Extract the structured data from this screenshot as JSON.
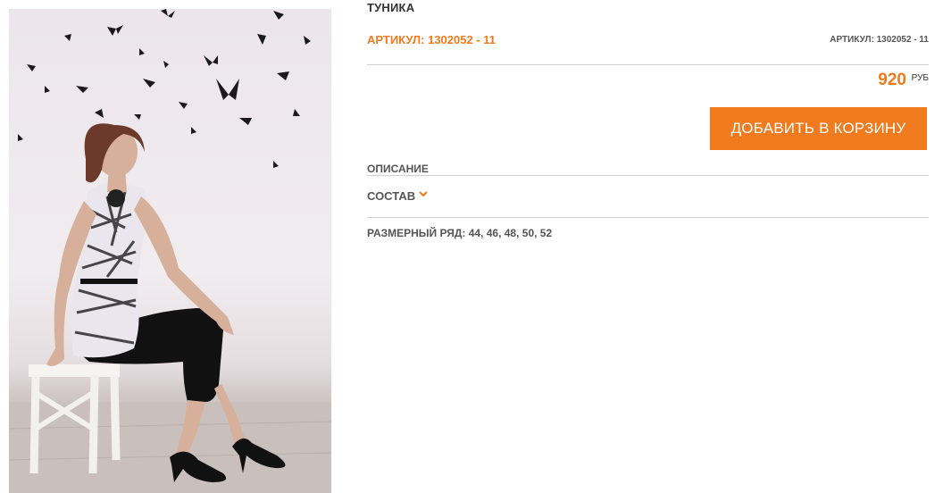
{
  "product": {
    "title": "ТУНИКА",
    "sku": "АРТИКУЛ: 1302052 - 11",
    "sku_secondary": "АРТИКУЛ: 1302052 - 11",
    "price": "920",
    "currency": "РУБ",
    "photo_icon": "product-photo"
  },
  "actions": {
    "add_to_cart_label": "ДОБАВИТЬ В КОРЗИНУ"
  },
  "sections": {
    "description_label": "ОПИСАНИЕ",
    "composition_label": "СОСТАВ",
    "composition_icon": "chevron-down-icon",
    "size_range": "РАЗМЕРНЫЙ РЯД: 44, 46, 48, 50, 52"
  },
  "colors": {
    "accent": "#f07a1e",
    "text": "#555555",
    "rule": "#cfcfcf"
  }
}
